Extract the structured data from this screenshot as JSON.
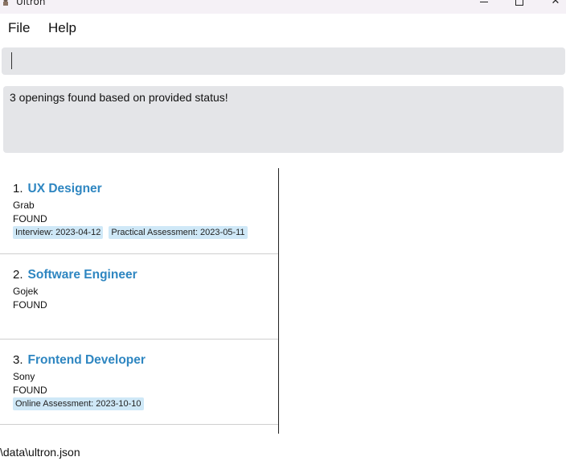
{
  "window": {
    "title": "Ultron",
    "min_symbol": "—",
    "close_symbol": "✕"
  },
  "menu": {
    "file": "File",
    "help": "Help"
  },
  "command": {
    "value": "",
    "placeholder": ""
  },
  "result": {
    "message": "3 openings found based on provided status!"
  },
  "openings": [
    {
      "index": "1.",
      "title": "UX Designer",
      "company": "Grab",
      "status": "FOUND",
      "events": [
        "Interview: 2023-04-12",
        "Practical Assessment: 2023-05-11"
      ]
    },
    {
      "index": "2.",
      "title": "Software Engineer",
      "company": "Gojek",
      "status": "FOUND",
      "events": []
    },
    {
      "index": "3.",
      "title": "Frontend Developer",
      "company": "Sony",
      "status": "FOUND",
      "events": [
        "Online Assessment: 2023-10-10"
      ]
    }
  ],
  "status_bar": {
    "path": "\\data\\ultron.json"
  },
  "colors": {
    "title_accent": "#2e86c1",
    "tag_bg": "#cfe8f7",
    "box_bg": "#e4e5e8"
  }
}
